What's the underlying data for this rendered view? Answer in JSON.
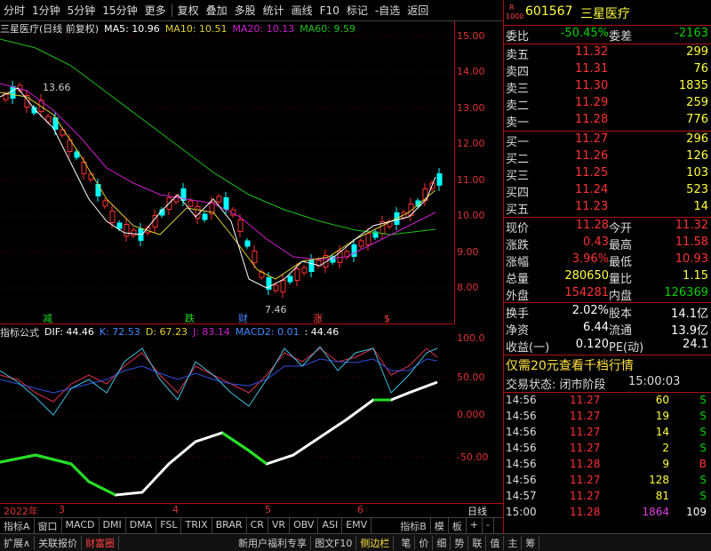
{
  "toolbar": {
    "items": [
      "分时",
      "1分钟",
      "5分钟",
      "15分钟",
      "更多",
      "复权",
      "叠加",
      "多股",
      "统计",
      "画线",
      "F10",
      "标记",
      "-自选",
      "返回"
    ]
  },
  "chart_header": {
    "name": "三星医疗(日线 前复权)",
    "ma5": "MA5: 10.96",
    "ma10": "MA10: 10.51",
    "ma20": "MA20: 10.13",
    "ma60": "MA60: 9.59"
  },
  "price_axis": [
    "15.00",
    "14.00",
    "13.00",
    "12.00",
    "11.00",
    "10.00",
    "9.00",
    "8.00"
  ],
  "annotations": {
    "high": "13.66",
    "low": "7.46",
    "m1": "减",
    "m2": "跌",
    "m3": "财",
    "m4": "涨",
    "m5": "$"
  },
  "sub_header": {
    "label": "指标公式",
    "dif": "DIF: 44.46",
    "k": "K: 72.53",
    "d": "D: 67.23",
    "j": "J: 83.14",
    "macd2": "MACD2: 0.01",
    "val": ": 44.46"
  },
  "sub_axis": [
    "100.0",
    "50.00",
    "0.000",
    "-50.00"
  ],
  "dates": {
    "d0": "2022年",
    "d1": "3",
    "d2": "4",
    "d3": "5",
    "d4": "6",
    "right": "日线"
  },
  "bottom_tabs": [
    "指标A",
    "窗口",
    "MACD",
    "DMI",
    "DMA",
    "FSL",
    "TRIX",
    "BRAR",
    "CR",
    "VR",
    "OBV",
    "ASI",
    "EMV",
    "指标B",
    "模",
    "板",
    "+",
    "-"
  ],
  "status_bar": [
    "扩展∧",
    "关联报价",
    "财富圈",
    "新用户福利专享",
    "图文F10",
    "侧边栏"
  ],
  "status_icons": [
    "笔",
    "价",
    "细",
    "势",
    "联",
    "值",
    "主",
    "筹"
  ],
  "stock": {
    "code": "601567",
    "name": "三星医疗",
    "badge_top": "R",
    "badge_bottom": "1000"
  },
  "wei": {
    "label": "委比",
    "value": "-50.45%",
    "label2": "委差",
    "value2": "-2163"
  },
  "sell": [
    {
      "l": "卖五",
      "p": "11.32",
      "v": "299"
    },
    {
      "l": "卖四",
      "p": "11.31",
      "v": "76"
    },
    {
      "l": "卖三",
      "p": "11.30",
      "v": "1835"
    },
    {
      "l": "卖二",
      "p": "11.29",
      "v": "259"
    },
    {
      "l": "卖一",
      "p": "11.28",
      "v": "776"
    }
  ],
  "buy": [
    {
      "l": "买一",
      "p": "11.27",
      "v": "296"
    },
    {
      "l": "买二",
      "p": "11.26",
      "v": "126"
    },
    {
      "l": "买三",
      "p": "11.25",
      "v": "103"
    },
    {
      "l": "买四",
      "p": "11.24",
      "v": "523"
    },
    {
      "l": "买五",
      "p": "11.23",
      "v": "14"
    }
  ],
  "quote": [
    {
      "l": "现价",
      "v": "11.28",
      "l2": "今开",
      "v2": "11.32"
    },
    {
      "l": "涨跌",
      "v": "0.43",
      "l2": "最高",
      "v2": "11.58"
    },
    {
      "l": "涨幅",
      "v": "3.96%",
      "l2": "最低",
      "v2": "10.93"
    },
    {
      "l": "总量",
      "v": "280650",
      "l2": "量比",
      "v2": "1.15"
    },
    {
      "l": "外盘",
      "v": "154281",
      "l2": "内盘",
      "v2": "126369"
    }
  ],
  "stats": [
    {
      "l": "换手",
      "v": "2.02%",
      "l2": "股本",
      "v2": "14.1亿"
    },
    {
      "l": "净资",
      "v": "6.44",
      "l2": "流通",
      "v2": "13.9亿"
    },
    {
      "l": "收益(一)",
      "v": "0.120",
      "l2": "PE(动)",
      "v2": "24.1"
    }
  ],
  "promo": "仅需20元查看千档行情",
  "trade_state": {
    "label": "交易状态: 闭市阶段",
    "time": "15:00:03"
  },
  "ticks": [
    {
      "t": "14:56",
      "p": "11.27",
      "v": "60",
      "s": "S"
    },
    {
      "t": "14:56",
      "p": "11.27",
      "v": "19",
      "s": "S"
    },
    {
      "t": "14:56",
      "p": "11.27",
      "v": "14",
      "s": "S"
    },
    {
      "t": "14:56",
      "p": "11.27",
      "v": "2",
      "s": "S"
    },
    {
      "t": "14:56",
      "p": "11.28",
      "v": "9",
      "s": "B"
    },
    {
      "t": "14:56",
      "p": "11.27",
      "v": "128",
      "s": "S"
    },
    {
      "t": "14:57",
      "p": "11.27",
      "v": "81",
      "s": "S"
    },
    {
      "t": "15:00",
      "p": "11.28",
      "v": "1864",
      "s": "109"
    }
  ]
}
